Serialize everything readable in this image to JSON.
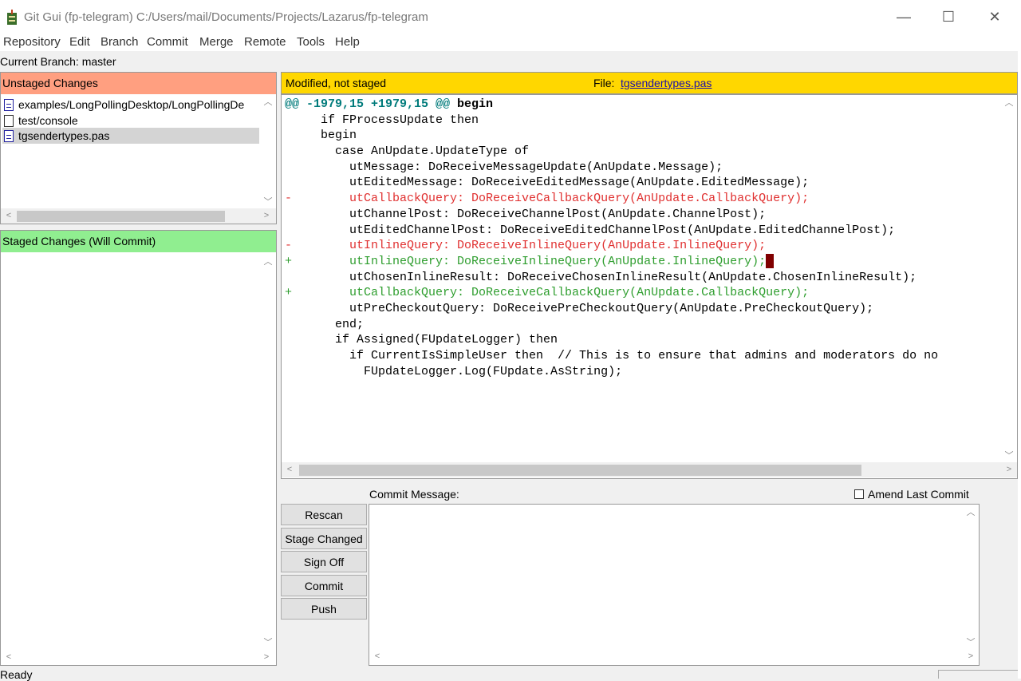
{
  "window": {
    "title": "Git Gui (fp-telegram) C:/Users/mail/Documents/Projects/Lazarus/fp-telegram",
    "controls": {
      "minimize": "—",
      "maximize": "☐",
      "close": "✕"
    }
  },
  "menu": [
    "Repository",
    "Edit",
    "Branch",
    "Commit",
    "Merge",
    "Remote",
    "Tools",
    "Help"
  ],
  "branch_label": "Current Branch: master",
  "unstaged": {
    "title": "Unstaged Changes",
    "files": [
      {
        "name": "examples/LongPollingDesktop/LongPollingDe",
        "icon": "modified-file-icon",
        "selected": false
      },
      {
        "name": "test/console",
        "icon": "untracked-file-icon",
        "selected": false
      },
      {
        "name": "tgsendertypes.pas",
        "icon": "modified-file-icon",
        "selected": true
      }
    ]
  },
  "staged": {
    "title": "Staged Changes (Will Commit)",
    "files": []
  },
  "diff": {
    "status": "Modified, not staged",
    "file_label": "File:",
    "file_name": "tgsendertypes.pas",
    "lines": [
      {
        "type": "hunk",
        "sign": "",
        "text": "@@ -1979,15 +1979,15 @@ ",
        "fn": "begin"
      },
      {
        "type": "ctx",
        "sign": "",
        "text": "     if FProcessUpdate then"
      },
      {
        "type": "ctx",
        "sign": "",
        "text": "     begin"
      },
      {
        "type": "ctx",
        "sign": "",
        "text": "       case AnUpdate.UpdateType of"
      },
      {
        "type": "ctx",
        "sign": "",
        "text": "         utMessage: DoReceiveMessageUpdate(AnUpdate.Message);"
      },
      {
        "type": "ctx",
        "sign": "",
        "text": "         utEditedMessage: DoReceiveEditedMessage(AnUpdate.EditedMessage);"
      },
      {
        "type": "del",
        "sign": "-",
        "text": "         utCallbackQuery: DoReceiveCallbackQuery(AnUpdate.CallbackQuery);"
      },
      {
        "type": "ctx",
        "sign": "",
        "text": "         utChannelPost: DoReceiveChannelPost(AnUpdate.ChannelPost);"
      },
      {
        "type": "ctx",
        "sign": "",
        "text": "         utEditedChannelPost: DoReceiveEditedChannelPost(AnUpdate.EditedChannelPost);"
      },
      {
        "type": "del",
        "sign": "-",
        "text": "         utInlineQuery: DoReceiveInlineQuery(AnUpdate.InlineQuery);"
      },
      {
        "type": "add",
        "sign": "+",
        "text": "         utInlineQuery: DoReceiveInlineQuery(AnUpdate.InlineQuery);",
        "cursor": true
      },
      {
        "type": "ctx",
        "sign": "",
        "text": "         utChosenInlineResult: DoReceiveChosenInlineResult(AnUpdate.ChosenInlineResult);"
      },
      {
        "type": "add",
        "sign": "+",
        "text": "         utCallbackQuery: DoReceiveCallbackQuery(AnUpdate.CallbackQuery);"
      },
      {
        "type": "ctx",
        "sign": "",
        "text": "         utPreCheckoutQuery: DoReceivePreCheckoutQuery(AnUpdate.PreCheckoutQuery);"
      },
      {
        "type": "ctx",
        "sign": "",
        "text": "       end;"
      },
      {
        "type": "ctx",
        "sign": "",
        "text": "       if Assigned(FUpdateLogger) then"
      },
      {
        "type": "ctx",
        "sign": "",
        "text": "         if CurrentIsSimpleUser then  // This is to ensure that admins and moderators do no"
      },
      {
        "type": "ctx",
        "sign": "",
        "text": "           FUpdateLogger.Log(FUpdate.AsString);"
      }
    ]
  },
  "commit": {
    "message_label": "Commit Message:",
    "amend_label": "Amend Last Commit",
    "message_value": "",
    "buttons": {
      "rescan": "Rescan",
      "stage_changed": "Stage Changed",
      "sign_off": "Sign Off",
      "commit": "Commit",
      "push": "Push"
    }
  },
  "status": "Ready"
}
